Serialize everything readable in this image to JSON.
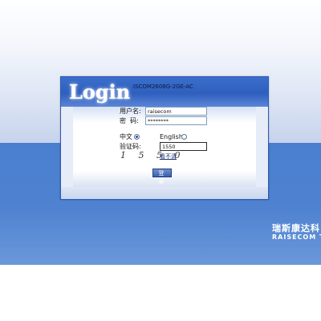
{
  "login": {
    "title": "Login",
    "model": "ISCOM2608G-2GE-AC",
    "username_label": "用户名:",
    "username_value": "raisecom",
    "password_label": "密  码:",
    "password_value": "********",
    "lang_chinese": "中文",
    "lang_english": "English",
    "lang_selected": "中文",
    "captcha_label": "验证码:",
    "captcha_value": "1550",
    "captcha_image": "1 5 5 0",
    "refresh_link": "看不清",
    "submit_label": "登 录"
  },
  "brand": {
    "name_cn": "瑞斯康达科",
    "name_en": "RAISECOM T"
  },
  "colors": {
    "header_blue": "#2f5fbe",
    "band_blue": "#4f83d1",
    "panel_bg": "#e6ecf8"
  }
}
